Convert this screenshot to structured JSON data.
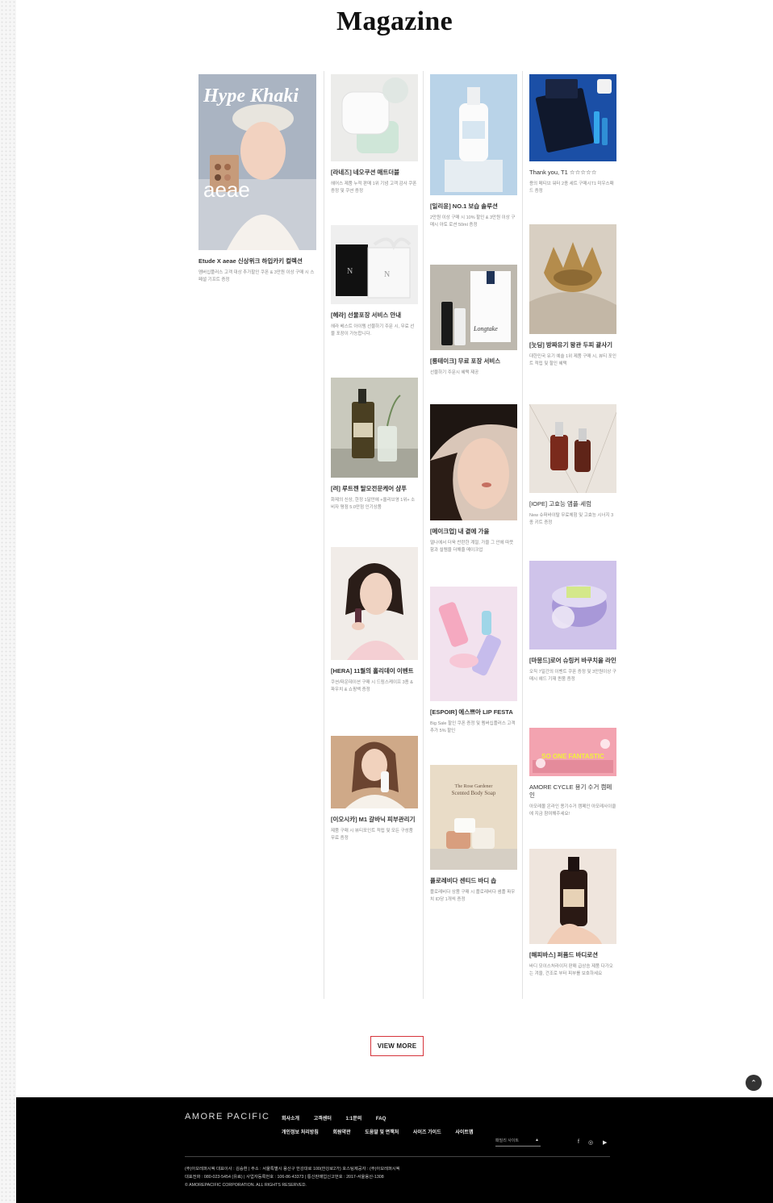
{
  "page": {
    "title": "Magazine"
  },
  "cards": [
    {
      "title": "Etude X aeae 신상위크 하입카키 컬렉션",
      "desc": "멤버십플러스 고객 대상 추가할인 쿠폰 & 3만원 이상 구매 시 스페셜 기프트 증정",
      "cover_text": "Hype Khaki",
      "cover_logo": "aeae"
    },
    {
      "title": "[라네즈] 네오쿠션 매트더블",
      "desc": "헤어스 제품 누적 판매 1위 기념 고객 감사 쿠폰 증정 및 쿠션 증정"
    },
    {
      "title": "[헤라] 선물포장 서비스 안내",
      "desc": "헤라 베스트 아이템 선물하기 주문 시, 무료 선물 포장이 가능합니다."
    },
    {
      "title": "[려] 루트젠 탈모전문케어 샴푸",
      "desc": "화제의 신상, 한정 1달만에 +올리브영 1위+ 소비자 평점 5.0만점 인기상품"
    },
    {
      "title": "[HERA] 11월의 홀리데이 이벤트",
      "desc": "쿠션/파운데이션 구매 시 드림스케이프 3종 & 파우치 & 쇼핑백 증정"
    },
    {
      "title": "[이오시카] M1 갈바닉 피부관리기",
      "desc": "제품 구매 시 뷰티포인트 적립 및 모든 구성품 무료 증정"
    },
    {
      "title": "[일리윤] NO.1 보습 솔루션",
      "desc": "2만원 이상 구매 시 10% 할인 & 3만원 이상 구매시 아토 로션 50ml 증정"
    },
    {
      "title": "[롱테이크] 무료 포장 서비스",
      "desc": "선물하기 주문시 혜택 제공",
      "brand_label": "Longtake"
    },
    {
      "title": "[메이크업] 내 곁에 가을",
      "desc": "떨나에서 더욱 찬란한 계절, 가을 그 안에 따뜻함과 설렘을 더해줄 메이크업"
    },
    {
      "title": "[ESPOIR] 에스쁘아 LIP FESTA",
      "desc": "Big Sale 할인 쿠폰 증정 및 멤버십플러스 고객 추가 5% 할인"
    },
    {
      "title": "플로레비다 센티드 바디 솝",
      "desc": "플로레비다 상품 구매 시 플로레비다 샘플 파우치 ID당 1개씩 증정",
      "poster_line1": "The Rose Gardener",
      "poster_line2": "Scented Body Soap"
    },
    {
      "title": "Thank you, T1 ☆☆☆☆☆",
      "desc": "용의 메티브 워터 2종 세트 구매시T1 미우스패드 증정"
    },
    {
      "title": "[눗딩] 방짜유기 왕관 두피 괄사기",
      "desc": "대한민국 유기 예술 1위 제품 구매 시, 뷰티 포인트 적립 및 할인 혜택"
    },
    {
      "title": "[IOPE] 고효능 앰플·세럼",
      "desc": "New 슈퍼바이탈 무료체험 및 고효능 시너지 3종 키트 증정"
    },
    {
      "title": "[마몽드]로어 슈링커 바쿠치올 라인",
      "desc": "오직 7일간의 이벤트 쿠폰 증정 및 3만원이상 구매시 헤드 기재 퀸붐 증정"
    },
    {
      "title": "AMORE CYCLE 용기 수거 캠페인",
      "desc": "아모레몰 온라인 용기수거 캠페인 아모레사이클에 지금 참여해주세요!",
      "banner_text": "SO ONE FANTASTIC"
    },
    {
      "title": "[해피바스] 퍼퓸드 바디로션",
      "desc": "바디 모이스처라이저 판매 급상승 제품 다가오는 겨울, 건조로 부터 피부를 보호하세요"
    }
  ],
  "view_more": {
    "label": "VIEW MORE"
  },
  "top_button": {
    "label": "⌃"
  },
  "footer": {
    "brand": "AMORE PACIFIC",
    "nav_row1": [
      "회사소개",
      "고객센터",
      "1:1문의",
      "FAQ"
    ],
    "nav_row2": [
      "개인정보 처리방침",
      "회원약관",
      "도움말 및 면책처",
      "사이즈 가이드",
      "사이트맵"
    ],
    "family_site": "패밀리 사이트",
    "family_caret": "▲",
    "social": {
      "facebook": "f",
      "instagram": "◎",
      "youtube": "▶"
    },
    "info": [
      "(주)아모레퍼시픽 대표이사 : 김승환  |  주소 : 서울특별시 용산구 한강대로 100(한강로2가) 호스팅제공자 : (주)아모레퍼시픽",
      "대표전화 : 080-023-5454 (유료)  |  사업자등록번호 : 106-86-43373  |  통신판매업신고번호 : 2017-서울용산-1308",
      "© AMOREPACIFIC CORPORATION. ALL RIGHTS RESERVED."
    ]
  }
}
